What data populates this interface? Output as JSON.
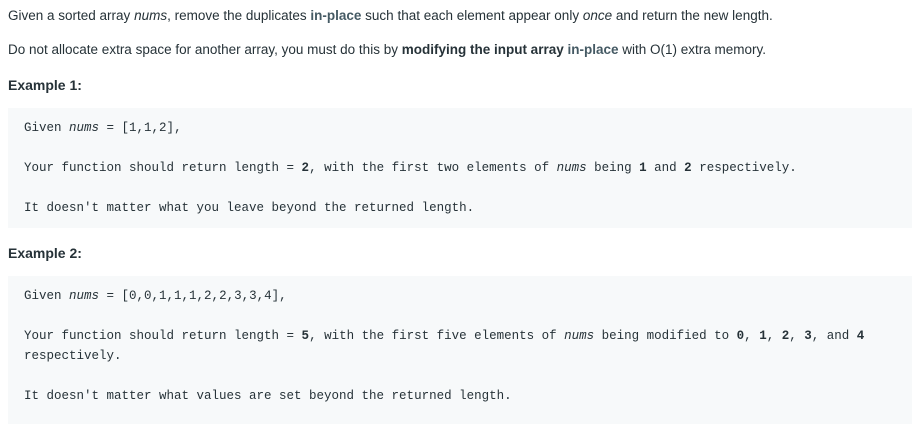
{
  "p1": {
    "t1": "Given a sorted array ",
    "nums": "nums",
    "t2": ", remove the duplicates ",
    "inplace": "in-place",
    "t3": " such that each element appear only ",
    "once": "once",
    "t4": " and return the new length."
  },
  "p2": {
    "t1": "Do not allocate extra space for another array, you must do this by ",
    "modifying": "modifying the input array",
    "sp": " ",
    "inplace": "in-place",
    "t2": " with O(1) extra memory."
  },
  "example1": {
    "title": "Example 1:",
    "line1_a": "Given ",
    "line1_var": "nums",
    "line1_b": " = ",
    "line1_arr": "[1,1,2]",
    "line1_c": ",",
    "line2_a": "Your function should return length = ",
    "line2_len": "2",
    "line2_b": ", with the first two elements of ",
    "line2_var": "nums",
    "line2_c": " being ",
    "line2_v1": "1",
    "line2_d": " and ",
    "line2_v2": "2",
    "line2_e": " respectively.",
    "line3": "It doesn't matter what you leave beyond the returned length."
  },
  "example2": {
    "title": "Example 2:",
    "line1_a": "Given ",
    "line1_var": "nums",
    "line1_b": " = ",
    "line1_arr": "[0,0,1,1,1,2,2,3,3,4]",
    "line1_c": ",",
    "line2_a": "Your function should return length = ",
    "line2_len": "5",
    "line2_b": ", with the first five elements of ",
    "line2_var": "nums",
    "line2_c": " being modified to ",
    "line2_v0": "0",
    "line2_s1": ", ",
    "line2_v1": "1",
    "line2_s2": ", ",
    "line2_v2": "2",
    "line2_s3": ", ",
    "line2_v3": "3",
    "line2_s4": ", and ",
    "line2_v4": "4",
    "line2_cont": "respectively.",
    "line3": "It doesn't matter what values are set beyond the returned length."
  }
}
